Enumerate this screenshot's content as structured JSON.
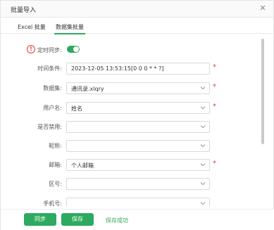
{
  "dialog": {
    "title": "批量导入",
    "close_glyph": "✕"
  },
  "tabs": [
    {
      "label": "Excel 批量"
    },
    {
      "label": "数据集批量",
      "active": true
    }
  ],
  "form": {
    "sync": {
      "label": "定时同步:",
      "enabled": true
    },
    "rows": [
      {
        "label": "时间条件:",
        "value": "2023-12-05 13:53:15[0 0 0 * * ?]",
        "required": true,
        "dropdown": false
      },
      {
        "label": "数据集:",
        "value": "通讯录.xlqry",
        "required": true,
        "dropdown": true
      },
      {
        "label": "用户名:",
        "value": "姓名",
        "required": true,
        "dropdown": true
      },
      {
        "label": "是否禁用:",
        "value": "",
        "required": false,
        "dropdown": true
      },
      {
        "label": "昵称:",
        "value": "",
        "required": false,
        "dropdown": true
      },
      {
        "label": "邮箱:",
        "value": "个人邮箱",
        "required": true,
        "dropdown": true
      },
      {
        "label": "区号:",
        "value": "",
        "required": false,
        "dropdown": true
      },
      {
        "label": "手机号:",
        "value": "",
        "required": false,
        "dropdown": true
      }
    ]
  },
  "footer": {
    "sync_button": "同步",
    "save_button": "保存",
    "status": "保存成功"
  },
  "colors": {
    "accent": "#2daa5f",
    "required": "#e53935"
  }
}
